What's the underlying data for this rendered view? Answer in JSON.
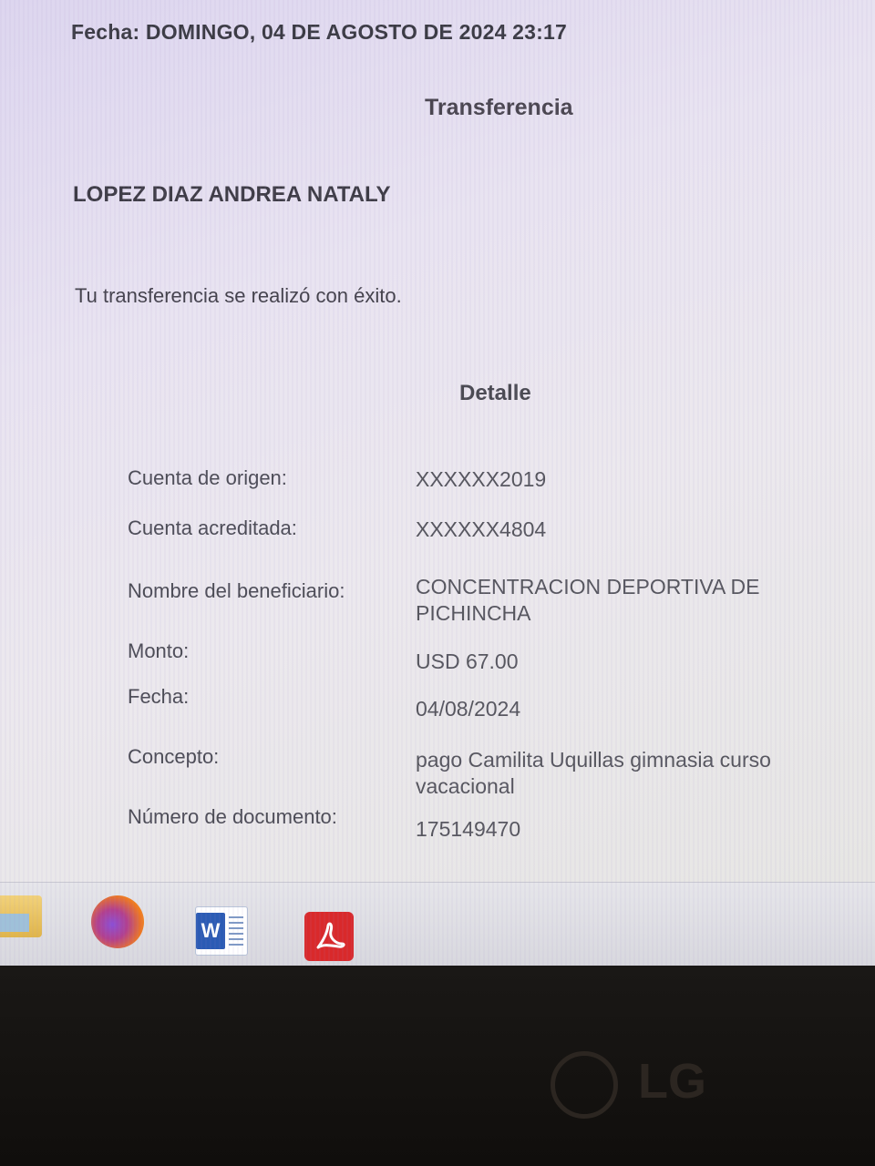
{
  "header": {
    "fecha": "Fecha: DOMINGO, 04 DE AGOSTO DE 2024 23:17"
  },
  "title": "Transferencia",
  "customer_name": "LOPEZ DIAZ ANDREA NATALY",
  "success_message": "Tu transferencia se realizó con éxito.",
  "detail_heading": "Detalle",
  "details": [
    {
      "label": "Cuenta de origen:",
      "value": "XXXXXX2019"
    },
    {
      "label": "Cuenta acreditada:",
      "value": "XXXXXX4804"
    },
    {
      "label": "Nombre del beneficiario:",
      "value": "CONCENTRACION DEPORTIVA DE PICHINCHA"
    },
    {
      "label": "Monto:",
      "value": "USD 67.00"
    },
    {
      "label": "Fecha:",
      "value": "04/08/2024"
    },
    {
      "label": "Concepto:",
      "value": "pago Camilita Uquillas gimnasia curso vacacional"
    },
    {
      "label": "Número de documento:",
      "value": "175149470"
    }
  ],
  "taskbar": {
    "icons": [
      "folder-icon",
      "firefox-icon",
      "word-icon",
      "pdf-icon"
    ],
    "word_letter": "W"
  },
  "monitor": {
    "brand": "LG"
  }
}
